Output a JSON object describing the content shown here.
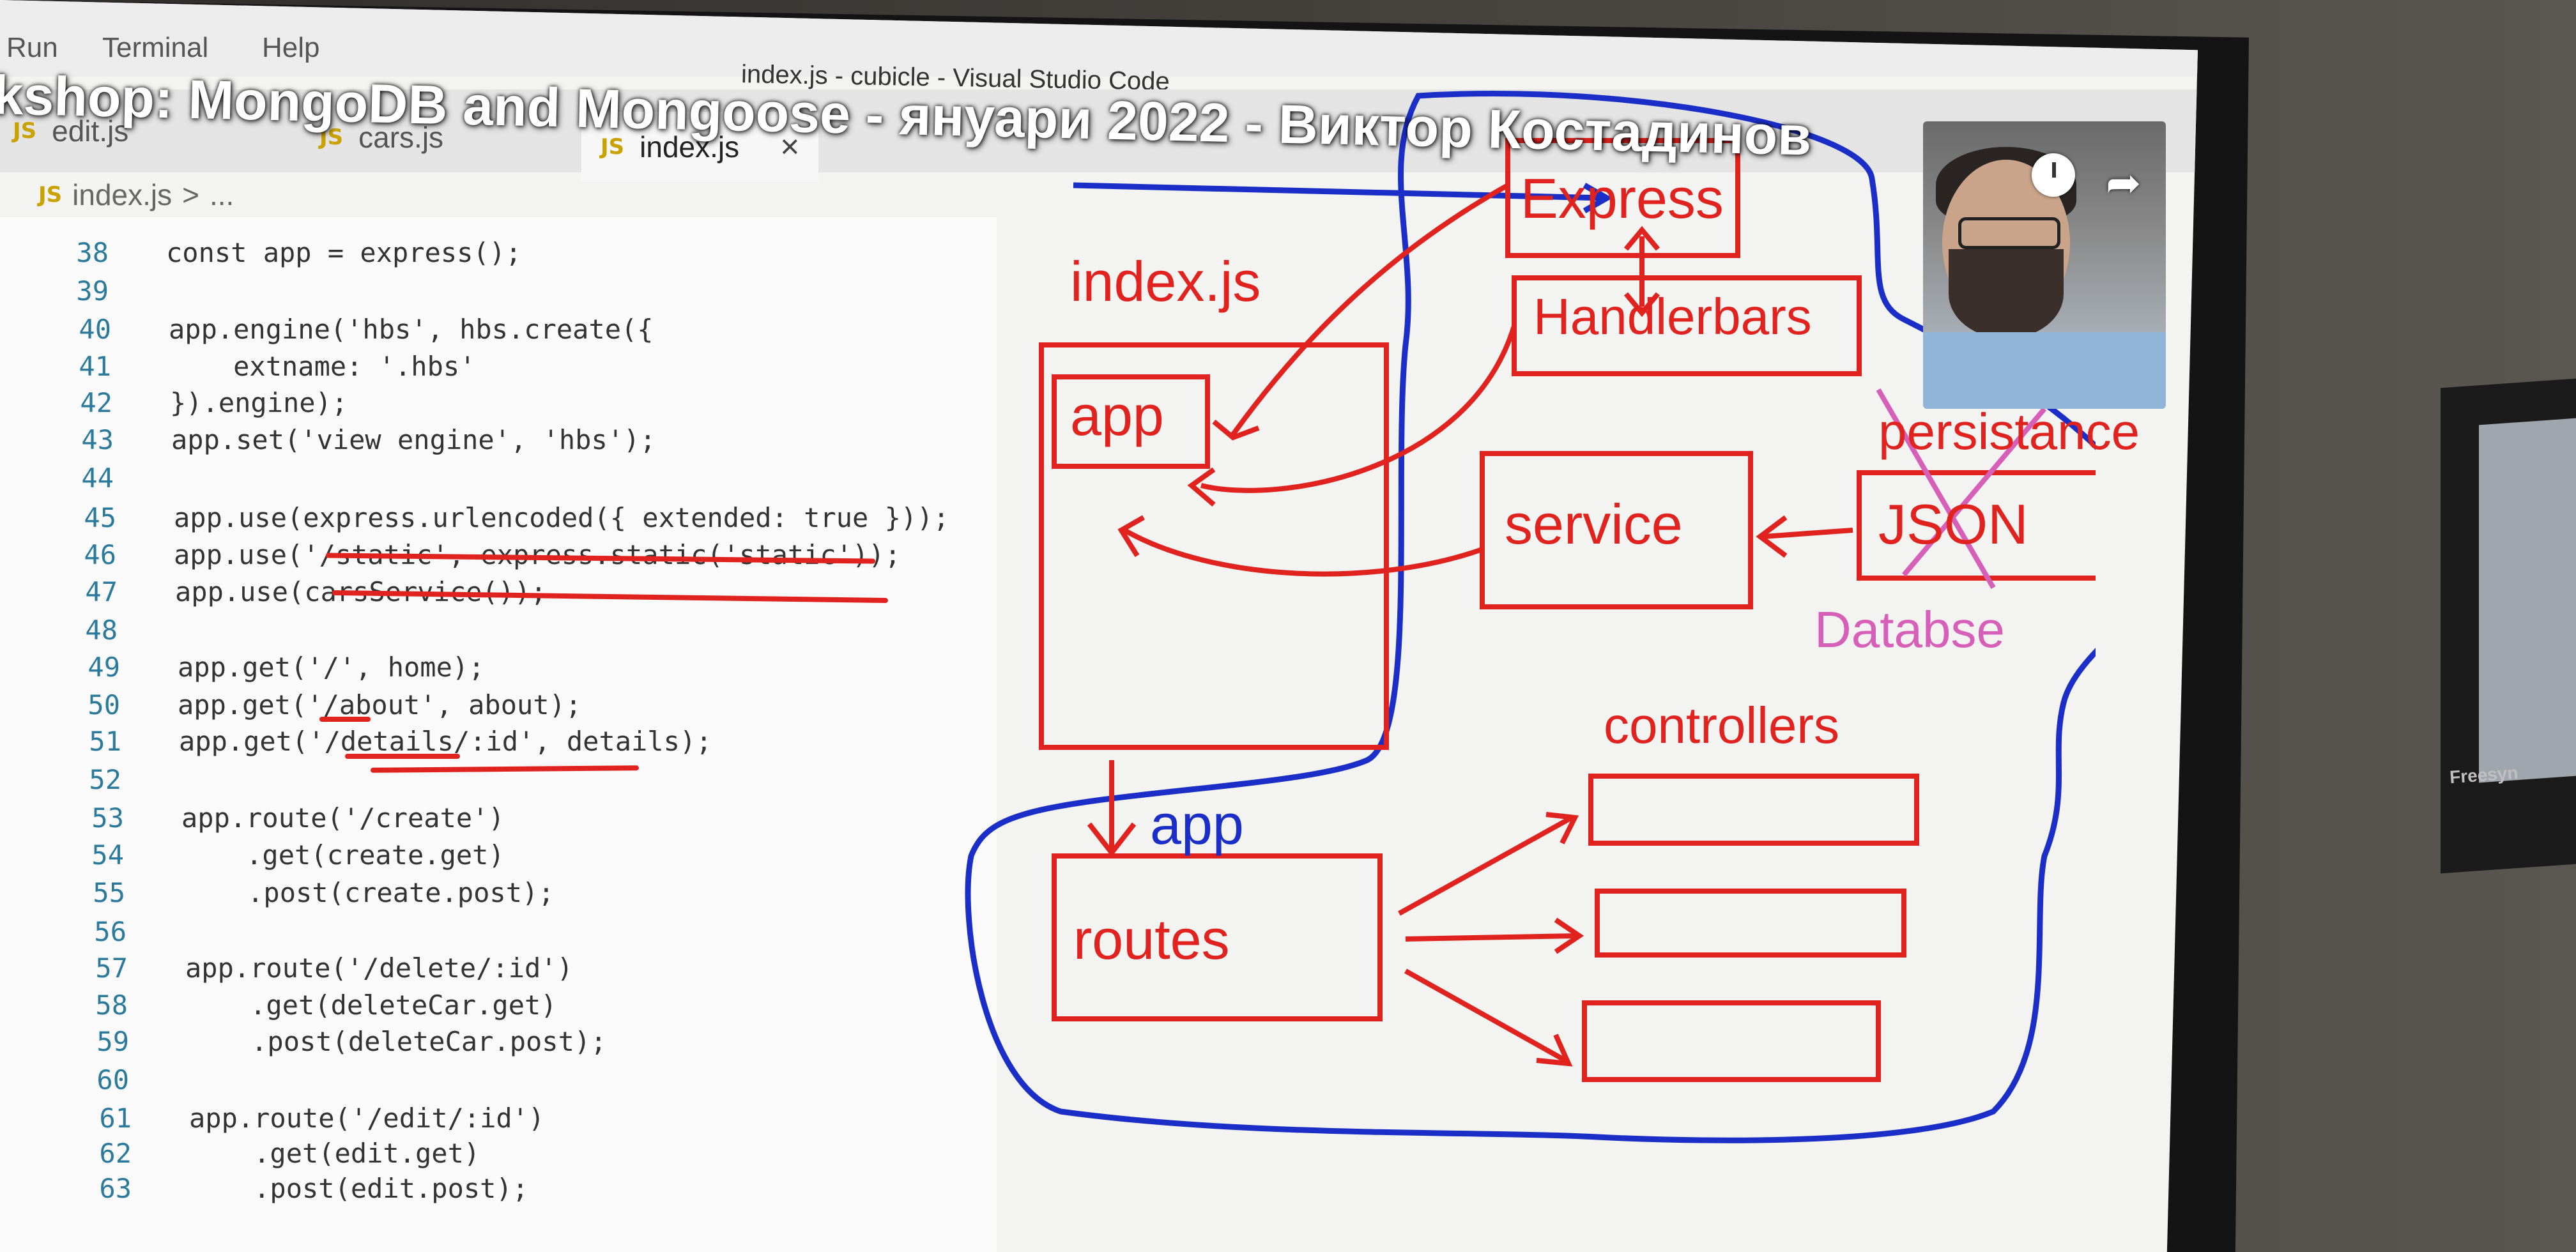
{
  "menu": {
    "items": [
      "Run",
      "Terminal",
      "Help"
    ]
  },
  "window_title": "index.js - cubicle - Visual Studio Code",
  "video_title": "kshop: MongoDB and Mongoose - януари 2022 - Виктор Костадинов",
  "tabs": [
    {
      "label": "edit.js",
      "icon": "JS"
    },
    {
      "label": "cars.js",
      "icon": "JS"
    },
    {
      "label": "index.js",
      "icon": "JS",
      "active": true
    }
  ],
  "tab_close_glyph": "×",
  "breadcrumb": {
    "icon": "JS",
    "file": "index.js",
    "sep": ">",
    "rest": "..."
  },
  "code_lines": [
    {
      "n": "38",
      "text": "const app = express();"
    },
    {
      "n": "39",
      "text": ""
    },
    {
      "n": "40",
      "text": "app.engine('hbs', hbs.create({"
    },
    {
      "n": "41",
      "text": "    extname: '.hbs'"
    },
    {
      "n": "42",
      "text": "}).engine);"
    },
    {
      "n": "43",
      "text": "app.set('view engine', 'hbs');"
    },
    {
      "n": "44",
      "text": ""
    },
    {
      "n": "45",
      "text": "app.use(express.urlencoded({ extended: true }));"
    },
    {
      "n": "46",
      "text": "app.use('/static', express.static('static'));"
    },
    {
      "n": "47",
      "text": "app.use(carsService());"
    },
    {
      "n": "48",
      "text": ""
    },
    {
      "n": "49",
      "text": "app.get('/', home);"
    },
    {
      "n": "50",
      "text": "app.get('/about', about);"
    },
    {
      "n": "51",
      "text": "app.get('/details/:id', details);"
    },
    {
      "n": "52",
      "text": ""
    },
    {
      "n": "53",
      "text": "app.route('/create')"
    },
    {
      "n": "54",
      "text": "    .get(create.get)"
    },
    {
      "n": "55",
      "text": "    .post(create.post);"
    },
    {
      "n": "56",
      "text": ""
    },
    {
      "n": "57",
      "text": "app.route('/delete/:id')"
    },
    {
      "n": "58",
      "text": "    .get(deleteCar.get)"
    },
    {
      "n": "59",
      "text": "    .post(deleteCar.post);"
    },
    {
      "n": "60",
      "text": ""
    },
    {
      "n": "61",
      "text": "app.route('/edit/:id')"
    },
    {
      "n": "62",
      "text": "    .get(edit.get)"
    },
    {
      "n": "63",
      "text": "    .post(edit.post);"
    }
  ],
  "diagram": {
    "express": "Express",
    "handlebars": "Handlerbars",
    "indexjs": "index.js",
    "app_box": "app",
    "service": "service",
    "persistance": "persistance",
    "json": "JSON",
    "database": "Databse",
    "controllers": "controllers",
    "app_arrow": "app",
    "routes": "routes"
  },
  "bezel_label": "Freesyn",
  "colors": {
    "annotation_red": "#e0231f",
    "annotation_blue": "#1b2fc8",
    "annotation_pink": "#d660b8"
  }
}
